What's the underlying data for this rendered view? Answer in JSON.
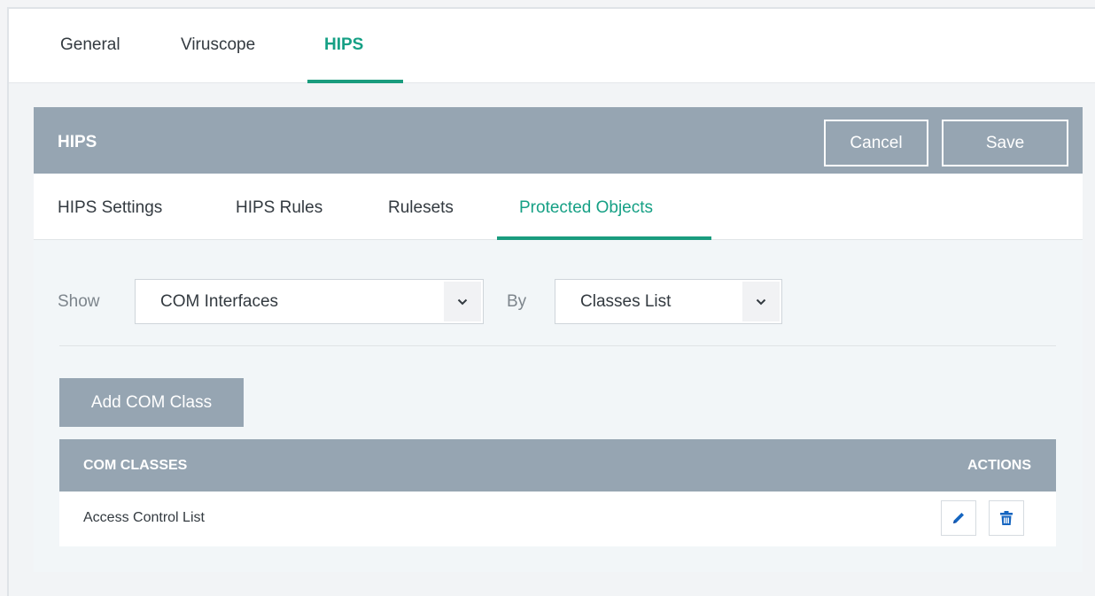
{
  "top_tabs": [
    {
      "label": "General",
      "active": false
    },
    {
      "label": "Viruscope",
      "active": false
    },
    {
      "label": "HIPS",
      "active": true
    }
  ],
  "panel": {
    "title": "HIPS",
    "cancel_label": "Cancel",
    "save_label": "Save"
  },
  "sub_tabs": [
    {
      "label": "HIPS Settings",
      "active": false
    },
    {
      "label": "HIPS Rules",
      "active": false
    },
    {
      "label": "Rulesets",
      "active": false
    },
    {
      "label": "Protected Objects",
      "active": true
    }
  ],
  "filters": {
    "show_label": "Show",
    "show_value": "COM Interfaces",
    "by_label": "By",
    "by_value": "Classes List"
  },
  "add_button_label": "Add COM Class",
  "table": {
    "headers": {
      "classes": "COM CLASSES",
      "actions": "ACTIONS"
    },
    "rows": [
      {
        "name": "Access Control List"
      }
    ]
  },
  "icons": {
    "dropdown": "chevron-down-icon",
    "edit": "pencil-icon",
    "delete": "trash-icon"
  },
  "colors": {
    "accent": "#16a085",
    "header_bg": "#96a5b2",
    "action_icon": "#1565c0"
  }
}
